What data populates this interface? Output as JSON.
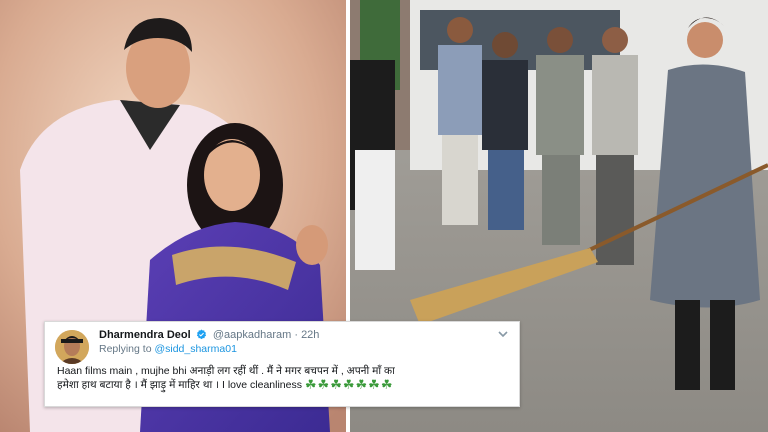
{
  "tweet": {
    "display_name": "Dharmendra Deol",
    "handle": "@aapkadharam",
    "separator": "·",
    "time": "22h",
    "replying_label": "Replying to",
    "reply_handle": "@sidd_sharma01",
    "body_line1": "Haan films main , mujhe bhi अनाड़ी लग रहीं  थीं . मैं ने मगर बचपन में , अपनी माँ का",
    "body_line2": "हमेशा हाथ बटाया है । मैं झाड़ु में माहिर था । I love cleanliness",
    "emoji": "☘☘☘☘☘☘☘"
  },
  "icons": {
    "verified": "verified-badge-icon",
    "menu": "chevron-down-icon"
  },
  "colors": {
    "link": "#1b95e0",
    "verified": "#1da1f2",
    "name": "#14171a",
    "muted": "#657786"
  }
}
